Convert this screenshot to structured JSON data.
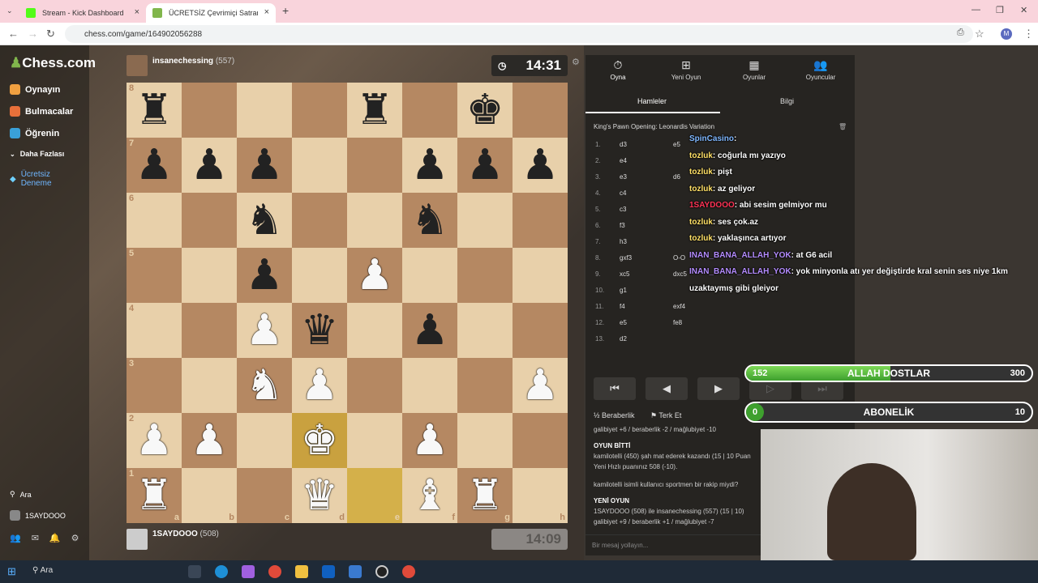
{
  "browser": {
    "tabs": [
      {
        "title": "Stream - Kick Dashboard",
        "active": false
      },
      {
        "title": "ÜCRETSİZ Çevrimiçi Satranç Oy",
        "active": true
      }
    ],
    "url": "chess.com/game/164902056288"
  },
  "sidebar": {
    "logo": "Chess.com",
    "items": [
      {
        "label": "Oynayın"
      },
      {
        "label": "Bulmacalar"
      },
      {
        "label": "Öğrenin"
      },
      {
        "label": "Daha Fazlası"
      },
      {
        "label": "Ücretsiz Deneme"
      }
    ],
    "search_label": "Ara",
    "user": "1SAYDOOO"
  },
  "top_player": {
    "name": "insanechessing",
    "rating": "(557)",
    "clock": "14:31"
  },
  "bottom_player": {
    "name": "1SAYDOOO",
    "rating": "(508)",
    "clock": "14:09"
  },
  "board": {
    "files": [
      "a",
      "b",
      "c",
      "d",
      "e",
      "f",
      "g",
      "h"
    ],
    "ranks": [
      "8",
      "7",
      "6",
      "5",
      "4",
      "3",
      "2",
      "1"
    ],
    "rows": [
      [
        "br",
        "",
        "",
        "",
        "br",
        "",
        "bk",
        ""
      ],
      [
        "bp",
        "bp",
        "bp",
        "",
        "",
        "bp",
        "bp",
        "bp"
      ],
      [
        "",
        "",
        "bn",
        "",
        "",
        "bn",
        "",
        ""
      ],
      [
        "",
        "",
        "bp",
        "",
        "wp",
        "",
        "",
        ""
      ],
      [
        "",
        "",
        "wp",
        "bq",
        "",
        "bp",
        "",
        ""
      ],
      [
        "",
        "",
        "wn",
        "wp",
        "",
        "",
        "",
        "wp"
      ],
      [
        "wp",
        "wp",
        "",
        "wk",
        "",
        "wp",
        "",
        ""
      ],
      [
        "wr",
        "",
        "",
        "wq",
        "",
        "wb",
        "wr",
        ""
      ]
    ]
  },
  "panel": {
    "tabs": [
      "Oyna",
      "Yeni Oyun",
      "Oyunlar",
      "Oyuncular"
    ],
    "subtabs": [
      "Hamleler",
      "Bilgi"
    ],
    "opening": "King's Pawn Opening: Leonardis Variation",
    "moves": [
      {
        "n": "1.",
        "w": "d3",
        "b": "e5"
      },
      {
        "n": "2.",
        "w": "e4",
        "b": ""
      },
      {
        "n": "3.",
        "w": "e3",
        "b": "d6"
      },
      {
        "n": "4.",
        "w": "c4",
        "b": ""
      },
      {
        "n": "5.",
        "w": "c3",
        "b": ""
      },
      {
        "n": "6.",
        "w": "f3",
        "b": ""
      },
      {
        "n": "7.",
        "w": "h3",
        "b": ""
      },
      {
        "n": "8.",
        "w": "gxf3",
        "b": "O-O"
      },
      {
        "n": "9.",
        "w": "xc5",
        "b": "dxc5"
      },
      {
        "n": "10.",
        "w": "g1",
        "b": ""
      },
      {
        "n": "11.",
        "w": "f4",
        "b": "exf4"
      },
      {
        "n": "12.",
        "w": "e5",
        "b": "fe8"
      },
      {
        "n": "13.",
        "w": "d2",
        "b": ""
      }
    ],
    "draw": "Beraberlik",
    "resign": "Terk Et",
    "log": [
      "galibiyet +6 / beraberlik -2 / mağlubiyet -10",
      "OYUN BİTTİ",
      "kamilotelli (450) şah mat ederek kazandı (15 | 10 Puan",
      "Yeni Hızlı puanınız 508 (-10).",
      "kamilotelli isimli kullanıcı sportmen bir rakip miydi?",
      "YENİ OYUN",
      "1SAYDOOO (508) ile insanechessing (557) (15 | 10)",
      "galibiyet +9 / beraberlik +1 / mağlubiyet -7"
    ],
    "message_placeholder": "Bir mesaj yollayın..."
  },
  "chat": [
    {
      "user": "SpinCasino",
      "text": ":"
    },
    {
      "user": "tozluk",
      "text": ": coğurla mı yazıyo"
    },
    {
      "user": "tozluk",
      "text": ": pişt"
    },
    {
      "user": "tozluk",
      "text": ": az geliyor"
    },
    {
      "user": "1SAYDOOO",
      "text": ": abi sesim gelmiyor mu"
    },
    {
      "user": "tozluk",
      "text": ": ses çok.az"
    },
    {
      "user": "tozluk",
      "text": ": yaklaşınca artıyor"
    },
    {
      "user": "INAN_BANA_ALLAH_YOK",
      "text": ": at G6 acil"
    },
    {
      "user": "INAN_BANA_ALLAH_YOK",
      "text": ": yok minyonla atı yer değiştirde kral senin ses niye 1km"
    },
    {
      "user": "",
      "text": "uzaktaymış gibi gleiyor"
    }
  ],
  "goals": [
    {
      "label": "ALLAH DOSTLAR",
      "current": "152",
      "target": "300",
      "progress": 0.507
    },
    {
      "label": "ABONELİK",
      "current": "0",
      "target": "10",
      "progress": 0.0
    }
  ],
  "taskbar": {
    "search": "Ara"
  },
  "colors": {
    "light": "#e8d0aa",
    "dark": "#b58862",
    "highlight": "#c9a13f",
    "accent": "#81b64c"
  }
}
